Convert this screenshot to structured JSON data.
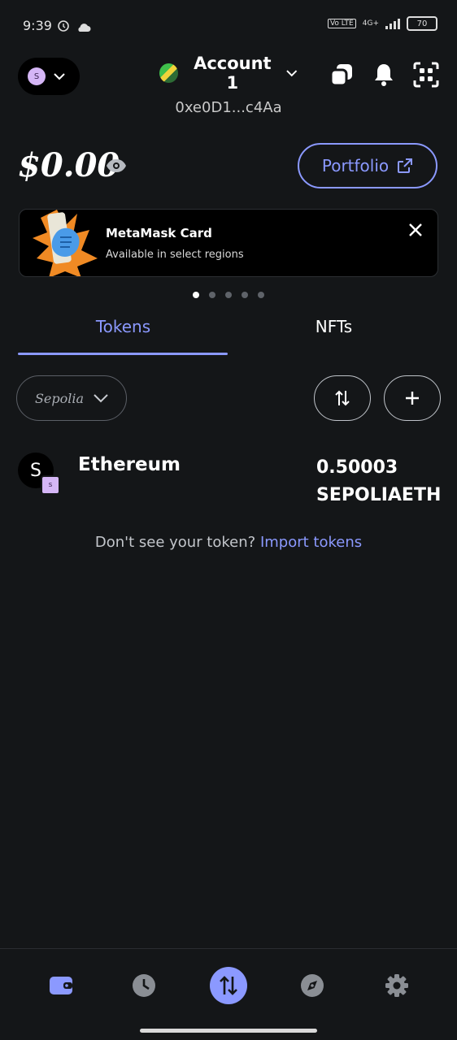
{
  "status_bar": {
    "time": "9:39",
    "network": "4G+",
    "volte": "Vo LTE",
    "battery": "70"
  },
  "header": {
    "network_avatar_letter": "S",
    "account_name": "Account 1",
    "account_address": "0xe0D1...c4Aa"
  },
  "balance": {
    "amount": "$0.00",
    "portfolio_label": "Portfolio"
  },
  "banner": {
    "title": "MetaMask Card",
    "subtitle": "Available in select regions"
  },
  "carousel": {
    "count": 5,
    "active_index": 0
  },
  "tabs": [
    {
      "label": "Tokens",
      "active": true
    },
    {
      "label": "NFTs",
      "active": false
    }
  ],
  "filter": {
    "network_label": "Sepolia"
  },
  "tokens": [
    {
      "avatar_letter": "S",
      "badge_letter": "s",
      "name": "Ethereum",
      "amount": "0.50003",
      "symbol": "SEPOLIAETH"
    }
  ],
  "import": {
    "prompt": "Don't see your token?",
    "link": "Import tokens"
  },
  "bottom_nav": [
    {
      "icon": "wallet-icon",
      "active": true
    },
    {
      "icon": "clock-icon",
      "active": false
    },
    {
      "icon": "swap-icon",
      "active": false
    },
    {
      "icon": "compass-icon",
      "active": false
    },
    {
      "icon": "gear-icon",
      "active": false
    }
  ],
  "colors": {
    "accent": "#8b99ff",
    "background": "#141618",
    "network_avatar": "#d5b6f6"
  }
}
